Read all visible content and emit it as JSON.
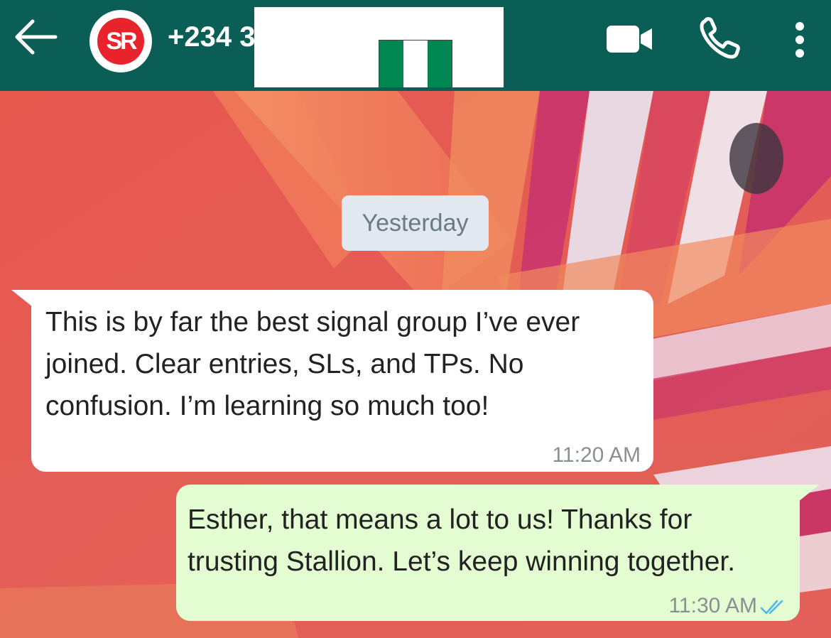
{
  "header": {
    "avatar_initials": "SR",
    "contact_name": "+234 3",
    "icons": [
      "back-arrow-icon",
      "video-call-icon",
      "voice-call-icon",
      "more-options-icon"
    ],
    "background_color": "#0b5e55",
    "flag_colors": [
      "#008751",
      "#ffffff",
      "#008751"
    ]
  },
  "chat": {
    "date_label": "Yesterday",
    "messages": [
      {
        "direction": "incoming",
        "text": "This is by far the best signal group I’ve ever joined. Clear entries, SLs, and TPs. No confusion. I’m learning so much too!",
        "time": "11:20 AM"
      },
      {
        "direction": "outgoing",
        "text": "Esther, that means a lot to us! Thanks for trusting Stallion. Let’s keep winning together.",
        "time": "11:30 AM",
        "status": "read"
      }
    ]
  },
  "colors": {
    "incoming_bubble": "#ffffff",
    "outgoing_bubble": "#e3fcd2",
    "read_tick": "#4fb6ec",
    "wallpaper": "#e45b55"
  }
}
